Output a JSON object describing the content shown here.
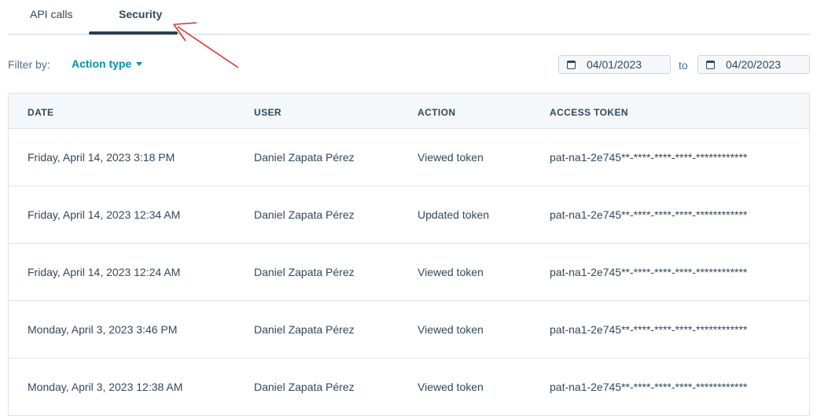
{
  "tabs": [
    {
      "label": "API calls"
    },
    {
      "label": "Security",
      "active": true
    }
  ],
  "filter": {
    "label": "Filter by:",
    "dropdown_label": "Action type"
  },
  "date_range": {
    "from": "04/01/2023",
    "separator": "to",
    "to": "04/20/2023"
  },
  "table": {
    "columns": [
      "DATE",
      "USER",
      "ACTION",
      "ACCESS TOKEN"
    ],
    "rows": [
      {
        "date": "Friday, April 14, 2023 3:18 PM",
        "user": "Daniel Zapata Pérez",
        "action": "Viewed token",
        "token": "pat-na1-2e745**-****-****-****-************"
      },
      {
        "date": "Friday, April 14, 2023 12:34 AM",
        "user": "Daniel Zapata Pérez",
        "action": "Updated token",
        "token": "pat-na1-2e745**-****-****-****-************"
      },
      {
        "date": "Friday, April 14, 2023 12:24 AM",
        "user": "Daniel Zapata Pérez",
        "action": "Viewed token",
        "token": "pat-na1-2e745**-****-****-****-************"
      },
      {
        "date": "Monday, April 3, 2023 3:46 PM",
        "user": "Daniel Zapata Pérez",
        "action": "Viewed token",
        "token": "pat-na1-2e745**-****-****-****-************"
      },
      {
        "date": "Monday, April 3, 2023 12:38 AM",
        "user": "Daniel Zapata Pérez",
        "action": "Viewed token",
        "token": "pat-na1-2e745**-****-****-****-************"
      }
    ]
  },
  "colors": {
    "accent": "#0091ae",
    "text": "#33475b",
    "annotation_arrow": "#e03030",
    "tab_underline": "#2d3e50"
  }
}
